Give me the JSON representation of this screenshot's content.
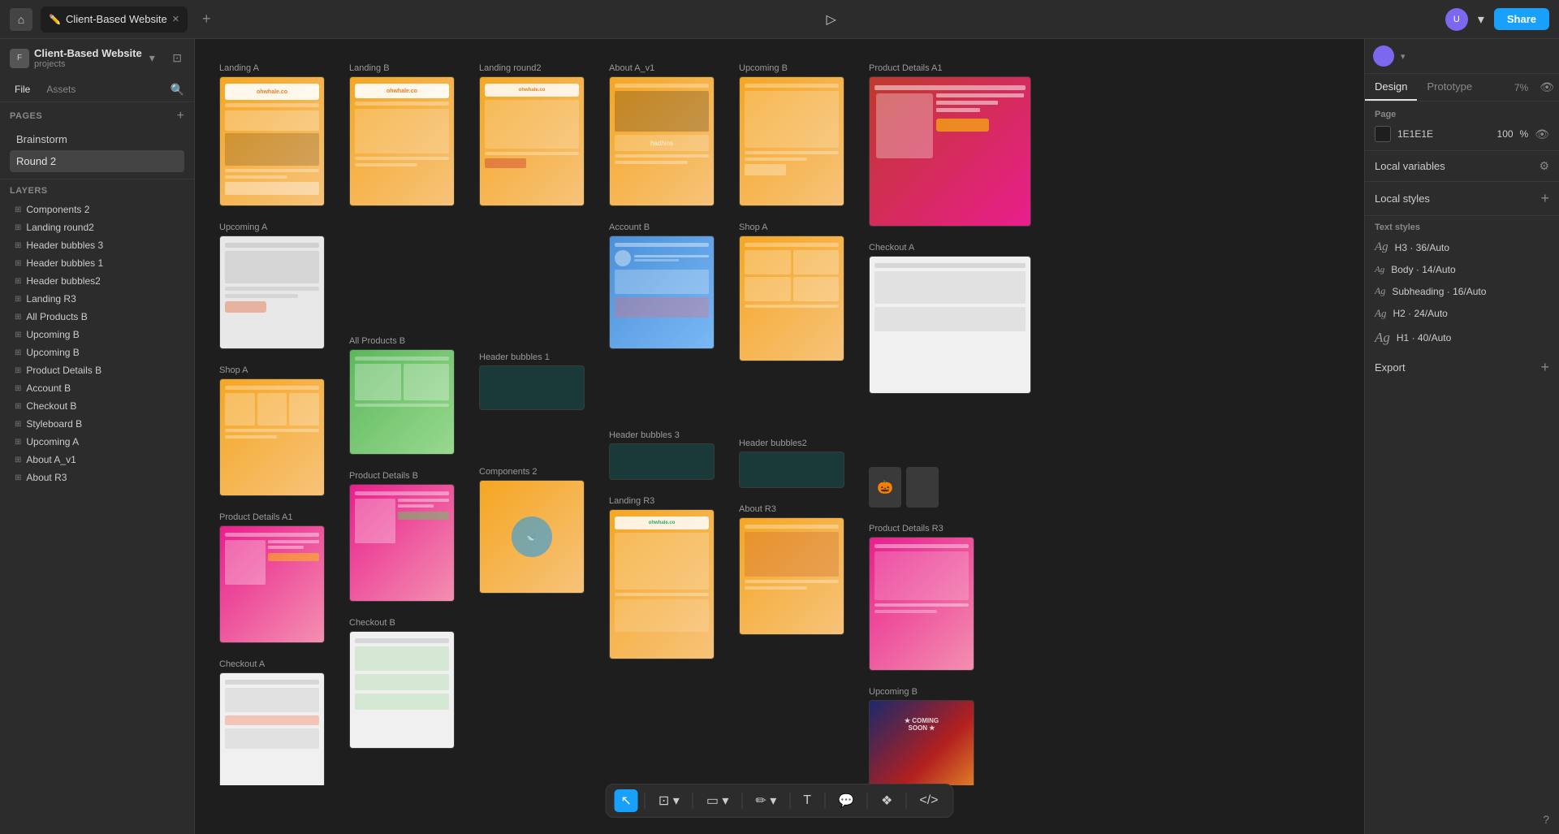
{
  "topbar": {
    "tab_label": "Client-Based Website",
    "share_label": "Share",
    "zoom": "7%"
  },
  "sidebar_left": {
    "project_name": "Client-Based Website",
    "project_sub": "projects",
    "file_label": "File",
    "assets_label": "Assets",
    "pages_label": "Pages",
    "pages": [
      {
        "id": "brainstorm",
        "label": "Brainstorm"
      },
      {
        "id": "round2",
        "label": "Round 2"
      }
    ],
    "layers_label": "Layers",
    "layers": [
      "Components 2",
      "Landing round2",
      "Header bubbles 3",
      "Header bubbles 1",
      "Header bubbles2",
      "Landing R3",
      "All Products B",
      "Upcoming B",
      "Upcoming B",
      "Product Details B",
      "Account B",
      "Checkout B",
      "Styleboard B",
      "Upcoming A",
      "About A_v1",
      "About R3"
    ]
  },
  "canvas": {
    "frames": [
      {
        "id": "landing-a",
        "label": "Landing A",
        "color": "orange",
        "col": 0
      },
      {
        "id": "landing-b",
        "label": "Landing B",
        "color": "orange",
        "col": 1
      },
      {
        "id": "landing-round2",
        "label": "Landing round2",
        "color": "orange",
        "col": 2
      },
      {
        "id": "about-a-v1",
        "label": "About A_v1",
        "color": "orange",
        "col": 3
      },
      {
        "id": "upcoming-b",
        "label": "Upcoming B",
        "color": "orange",
        "col": 4
      },
      {
        "id": "product-details-a1",
        "label": "Product Details A1",
        "color": "pink",
        "col": 5
      },
      {
        "id": "upcoming-a",
        "label": "Upcoming A",
        "color": "light",
        "col": 0
      },
      {
        "id": "account-b",
        "label": "Account B",
        "color": "blue",
        "col": 3
      },
      {
        "id": "shop-a-2",
        "label": "Shop A",
        "color": "orange",
        "col": 4
      },
      {
        "id": "checkout-a",
        "label": "Checkout A",
        "color": "light",
        "col": 5
      },
      {
        "id": "shop-a",
        "label": "Shop A",
        "color": "orange",
        "col": 0
      },
      {
        "id": "all-products-b",
        "label": "All Products B",
        "color": "green",
        "col": 1
      },
      {
        "id": "product-details-a1b",
        "label": "Product Details A1",
        "color": "pink",
        "col": 0
      },
      {
        "id": "product-details-b",
        "label": "Product Details B",
        "color": "pink",
        "col": 1
      },
      {
        "id": "checkout-a2",
        "label": "Checkout A",
        "color": "light",
        "col": 0
      },
      {
        "id": "checkout-b",
        "label": "Checkout B",
        "color": "light",
        "col": 1
      }
    ]
  },
  "right_panel": {
    "design_label": "Design",
    "prototype_label": "Prototype",
    "zoom_label": "7%",
    "page_section": "Page",
    "page_color": "1E1E1E",
    "page_opacity": "100",
    "local_variables_label": "Local variables",
    "local_styles_label": "Local styles",
    "text_styles_label": "Text styles",
    "text_styles": [
      {
        "id": "h3",
        "sample": "Ag",
        "label": "H3 · 36/Auto"
      },
      {
        "id": "body",
        "sample": "Ag",
        "label": "Body · 14/Auto"
      },
      {
        "id": "subheading",
        "sample": "Ag",
        "label": "Subheading · 16/Auto"
      },
      {
        "id": "h2",
        "sample": "Ag",
        "label": "H2 · 24/Auto"
      },
      {
        "id": "h1",
        "sample": "Ag",
        "label": "H1 · 40/Auto"
      }
    ],
    "export_label": "Export"
  },
  "toolbar": {
    "tools": [
      "selector",
      "frame",
      "rect",
      "pen",
      "text",
      "comment",
      "component",
      "code"
    ]
  }
}
